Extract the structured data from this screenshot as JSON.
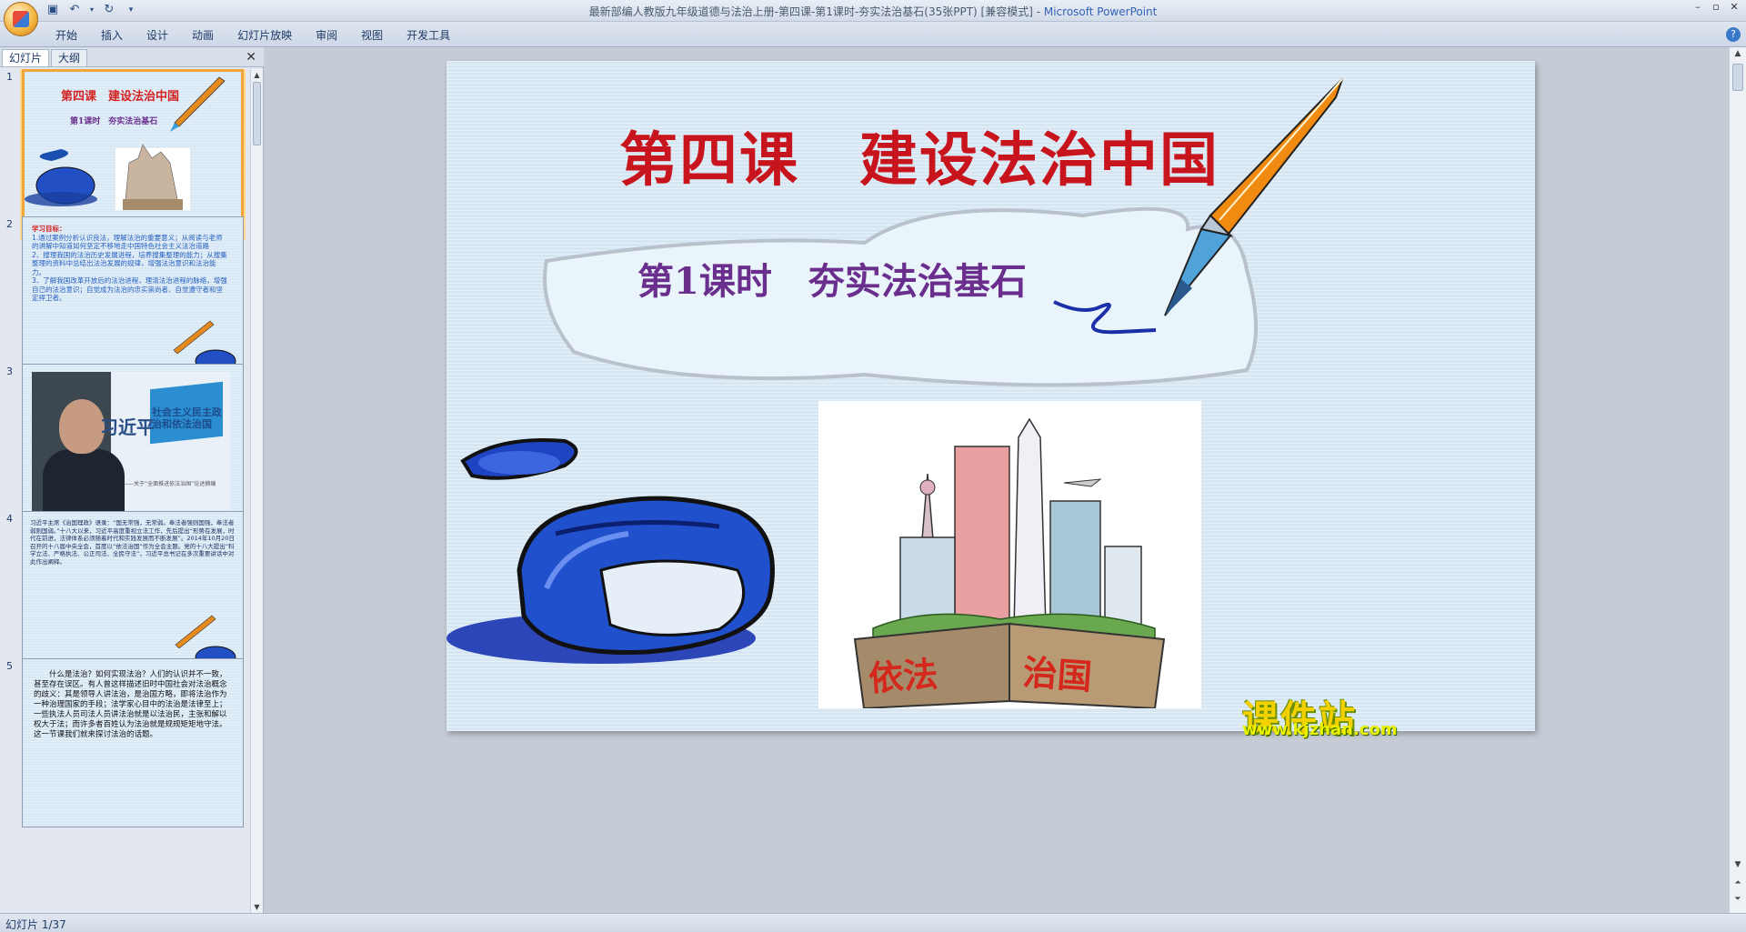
{
  "window": {
    "title": "最新部编人教版九年级道德与法治上册-第四课-第1课时-夯实法治基石(35张PPT) [兼容模式]",
    "separator": " - ",
    "app_name": "Microsoft PowerPoint"
  },
  "ribbon": {
    "tabs": [
      "开始",
      "插入",
      "设计",
      "动画",
      "幻灯片放映",
      "审阅",
      "视图",
      "开发工具"
    ]
  },
  "left_pane": {
    "tabs": [
      "幻灯片",
      "大纲"
    ],
    "close_glyph": "✕",
    "slides": [
      {
        "num": "1",
        "title": "第四课　建设法治中国",
        "subtitle": "第1课时　夯实法治基石"
      },
      {
        "num": "2",
        "heading": "学习目标：",
        "lines": [
          "1.通过案例分析认识良法，理解法治的重要意义；从阅读与老师的讲解中知道如何坚定不移地走中国特色社会主义法治道路",
          "2、搜理我国的法治历史发展进程，培养搜集整理的能力；从搜集整理的资料中总结出法治发展的规律，增强法治意识和法治能力。",
          "3、了解我国改革开放后的法治进程，理清法治进程的脉络，增强自己的法治意识；自觉成为法治的忠实崇尚者、自觉遵守者和坚定捍卫者。"
        ]
      },
      {
        "num": "3",
        "name": "习近平",
        "book": "社会主义民主政治和依法治国",
        "caption": "——关于“全面推进依法治国”论述摘编"
      },
      {
        "num": "4",
        "text": "习近平主席《治国理政》语录：“国无常强，无常弱。奉法者强则国强，奉法者弱则国弱。”十八大以来，习近平高度重视立法工作，先后提出“形势在发展，时代在前进，法律体系必须随着时代和实践发展而不断发展”。2014年10月20日召开的十八届中央全会，首度以“依法治国”作为全会主题。党的十八大提出“科学立法、严格执法、公正司法、全民守法”，习近平总书记在多次重要讲话中对此作出阐释。"
      },
      {
        "num": "5",
        "text": "什么是法治？如何实现法治？人们的认识并不一致，甚至存在误区。有人曾这样描述旧时中国社会对法治概念的歧义：其是领导人讲法治，是治国方略，即将法治作为一种治理国家的手段；法学家心目中的法治是法律至上；一些执法人员司法人员讲法治就是以法治民，主张和解以权大于法；而许多者百姓认为法治就是规规矩矩地守法。这一节课我们就来探讨法治的话题。"
      }
    ]
  },
  "slide": {
    "title": "第四课　建设法治中国",
    "subtitle": "第1课时　夯实法治基石",
    "image_banner_left": "依法",
    "image_banner_right": "治国"
  },
  "watermark": {
    "brand": "课件站",
    "url": "www.kjzhan.com"
  },
  "status": {
    "text": "幻灯片 1/37"
  }
}
